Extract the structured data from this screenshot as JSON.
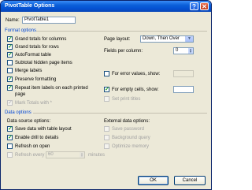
{
  "window": {
    "title": "PivotTable Options"
  },
  "name_field": {
    "label": "Name:",
    "value": "PivotTable1"
  },
  "format_options": {
    "heading": "Format options",
    "left": [
      {
        "label": "Grand totals for columns",
        "checked": true,
        "enabled": true
      },
      {
        "label": "Grand totals for rows",
        "checked": true,
        "enabled": true
      },
      {
        "label": "AutoFormat table",
        "checked": true,
        "enabled": true
      },
      {
        "label": "Subtotal hidden page items",
        "checked": false,
        "enabled": true
      },
      {
        "label": "Merge labels",
        "checked": false,
        "enabled": true
      },
      {
        "label": "Preserve formatting",
        "checked": true,
        "enabled": true
      },
      {
        "label": "Repeat item labels on each printed",
        "label2": "page",
        "checked": true,
        "enabled": true
      },
      {
        "label": "Mark Totals with *",
        "checked": true,
        "enabled": false
      }
    ],
    "page_layout": {
      "label": "Page layout:",
      "value": "Down, Then Over"
    },
    "fields_per_column": {
      "label": "Fields per column:",
      "value": "0"
    },
    "error_values": {
      "label": "For error values, show:",
      "checked": false,
      "value": ""
    },
    "empty_cells": {
      "label": "For empty cells, show:",
      "checked": true,
      "value": ""
    },
    "print_titles": {
      "label": "Set print titles",
      "checked": false,
      "enabled": false
    }
  },
  "data_options": {
    "heading": "Data options",
    "source_heading": "Data source options:",
    "source": [
      {
        "label": "Save data with table layout",
        "checked": true,
        "enabled": true
      },
      {
        "label": "Enable drill to details",
        "checked": true,
        "enabled": true
      },
      {
        "label": "Refresh on open",
        "checked": false,
        "enabled": true
      }
    ],
    "refresh_every": {
      "label": "Refresh every",
      "value": "60",
      "unit": "minutes",
      "checked": false,
      "enabled": false
    },
    "external_heading": "External data options:",
    "external": [
      {
        "label": "Save password",
        "checked": false,
        "enabled": false
      },
      {
        "label": "Background query",
        "checked": false,
        "enabled": false
      },
      {
        "label": "Optimize memory",
        "checked": false,
        "enabled": false
      }
    ]
  },
  "buttons": {
    "ok": "OK",
    "cancel": "Cancel"
  },
  "colors": {
    "title_bar": "#0a5fd8",
    "section_heading": "#0046d5",
    "dialog_bg": "#ece9d8"
  }
}
